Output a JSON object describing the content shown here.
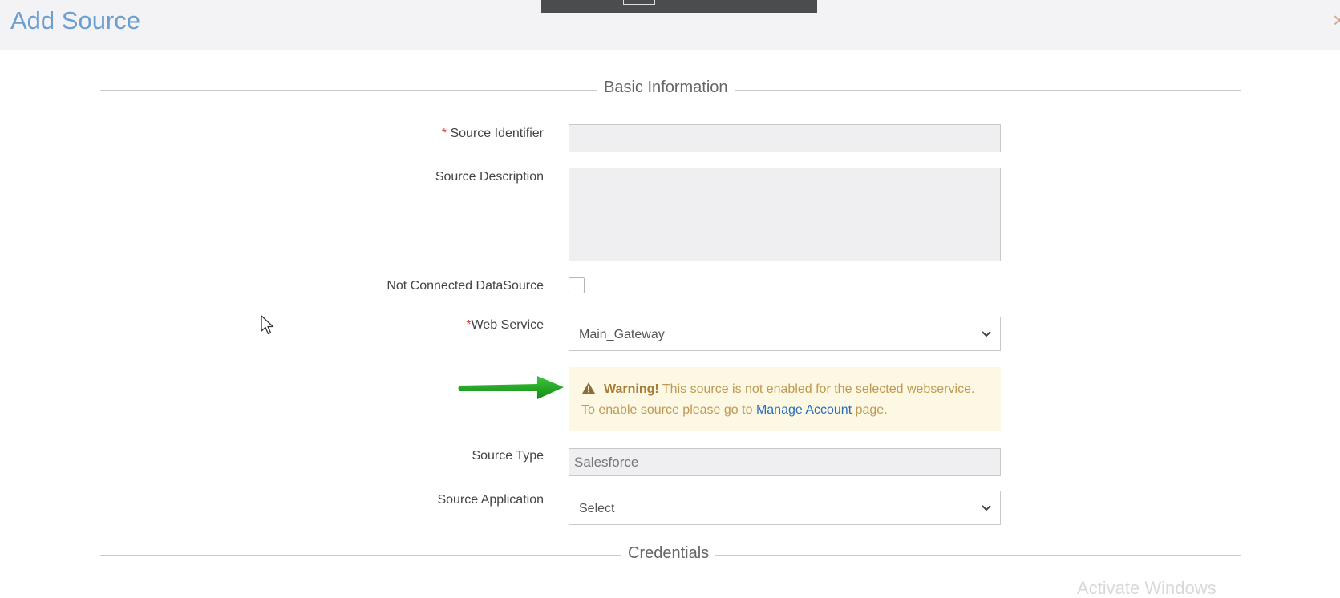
{
  "page": {
    "title": "Add Source",
    "close_glyph": "×"
  },
  "sections": {
    "basic": "Basic Information",
    "credentials": "Credentials"
  },
  "form": {
    "source_identifier": {
      "required_mark": "*",
      "label": "Source Identifier",
      "value": ""
    },
    "source_description": {
      "label": "Source Description",
      "value": ""
    },
    "not_connected": {
      "label": "Not Connected DataSource",
      "checked": false
    },
    "web_service": {
      "required_mark": "*",
      "label": "Web Service",
      "selected": "Main_Gateway"
    },
    "source_type": {
      "label": "Source Type",
      "value": "Salesforce"
    },
    "source_application": {
      "label": "Source Application",
      "selected": "Select"
    }
  },
  "warning": {
    "title": "Warning!",
    "message_before": " This source is not enabled for the selected webservice. To enable source please go to ",
    "link_label": "Manage Account",
    "message_after": " page."
  },
  "watermark": "Activate Windows",
  "colors": {
    "title": "#6a9fcf",
    "required": "#d43f3a",
    "warning_bg": "#fcf8e3",
    "warning_text": "#c09853",
    "link": "#2a6ebb",
    "arrow": "#1aa31a"
  },
  "icons": [
    "close-icon",
    "warning-icon",
    "chevron-down-icon",
    "arrow-pointer-icon",
    "mouse-cursor-icon"
  ]
}
